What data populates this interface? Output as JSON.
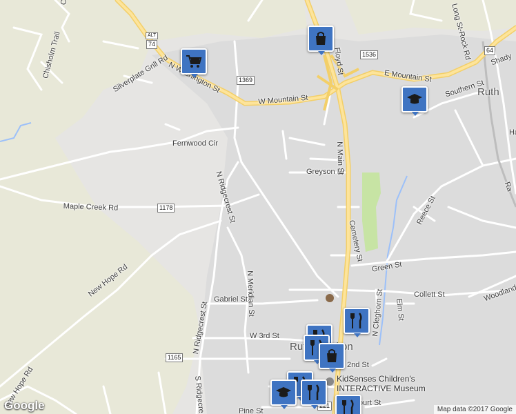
{
  "map": {
    "town_label": "Rutherfordton",
    "town2_label": "Ruth",
    "attribution": "Map data ©2017 Google",
    "logo": "Google",
    "colors": {
      "land": "#e6e5e3",
      "rural": "#e8e8d8",
      "urban": "#dcdcdc",
      "park": "#c7e4a4",
      "water": "#9cc0f9",
      "road": "#ffffff",
      "major_road": "#fbe18e",
      "pin": "#3f74c2"
    }
  },
  "roads": {
    "chisholm": "Chisholm Trail",
    "chisholm2": "Chish",
    "silverplate": "Silverplate Grill Rd",
    "n_washington": "N Washington St",
    "w_mountain": "W Mountain St",
    "e_mountain": "E Mountain St",
    "floyd": "Floyd St",
    "long_st_rock": "Long St-Rock Rd",
    "shady": "Shady",
    "southern": "Southern St",
    "fernwood": "Fernwood Cir",
    "greyson": "Greyson Dr",
    "n_main": "N Main St",
    "n_ridgecrest": "N Ridgecrest St",
    "maple_creek": "Maple Creek Rd",
    "reece": "Reece St",
    "cemetery": "Cemetery St",
    "green": "Green St",
    "new_hope": "New Hope Rd",
    "n_meridian": "N Meridian St",
    "gabriel": "Gabriel St",
    "collett": "Collett St",
    "woodland": "Woodland",
    "elm": "Elm St",
    "n_ridgecrest2": "N Ridgecrest St",
    "n_cleghorn": "N Cleghorn St",
    "w_3rd": "W 3rd St",
    "second": "2nd St",
    "new_hope2": "New Hope Rd",
    "s_ridgecrest": "S Ridgecre",
    "court": "Court St",
    "pine": "Pine St",
    "ra": "Ra",
    "ha": "Ha"
  },
  "shields": {
    "alt": "ALT",
    "us74": "74",
    "r1369": "1369",
    "r1536": "1536",
    "us64": "64",
    "r1178": "1178",
    "r1165": "1165",
    "r221": "221"
  },
  "pois": {
    "kidsenses_line1": "KidSenses Children's",
    "kidsenses_line2": "INTERACTIVE Museum"
  },
  "markers": [
    {
      "icon": "shopping-bag-icon",
      "label": "shopping"
    },
    {
      "icon": "shopping-cart-icon",
      "label": "grocery"
    },
    {
      "icon": "school-icon",
      "label": "school"
    },
    {
      "icon": "restaurant-icon",
      "label": "restaurant"
    },
    {
      "icon": "shopping-bag-icon",
      "label": "shopping"
    },
    {
      "icon": "school-icon",
      "label": "school"
    },
    {
      "icon": "restaurant-icon",
      "label": "restaurant"
    },
    {
      "icon": "restaurant-icon",
      "label": "restaurant"
    }
  ]
}
